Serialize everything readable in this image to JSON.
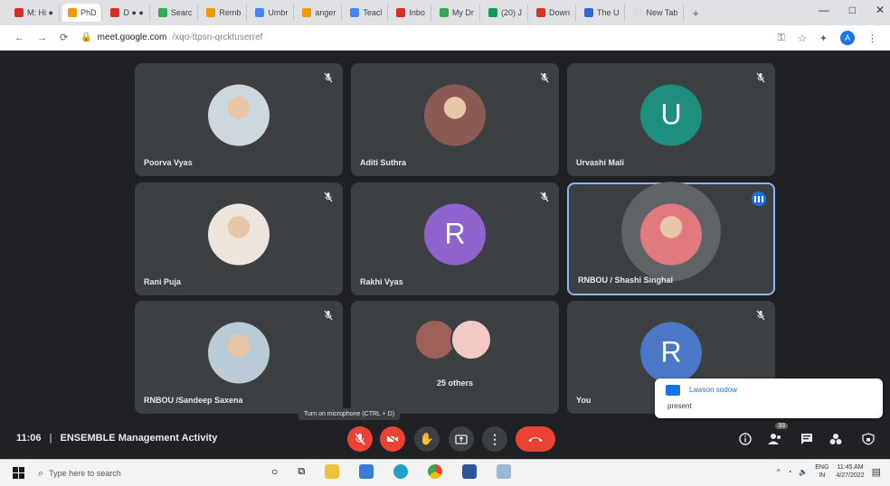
{
  "browser": {
    "tabs": [
      {
        "label": "M: Hi ●",
        "color": "#d93025"
      },
      {
        "label": "PhD",
        "color": "#f29900"
      },
      {
        "label": "D ● ●",
        "color": "#d93025"
      },
      {
        "label": "Searc",
        "color": "#34a853"
      },
      {
        "label": "Remb",
        "color": "#f29900"
      },
      {
        "label": "Umbr",
        "color": "#4285f4"
      },
      {
        "label": "anger",
        "color": "#f29900"
      },
      {
        "label": "Teacl",
        "color": "#4285f4"
      },
      {
        "label": "Inbo",
        "color": "#d93025"
      },
      {
        "label": "My Dr",
        "color": "#34a853"
      },
      {
        "label": "(20) J",
        "color": "#0f9d58"
      },
      {
        "label": "Down",
        "color": "#d93025"
      },
      {
        "label": "The U",
        "color": "#3367d6"
      },
      {
        "label": "New Tab",
        "color": "#dadce0"
      }
    ],
    "new_tab": "+",
    "window_controls": [
      "—",
      "□",
      "✕"
    ],
    "url_host": "meet.google.com",
    "url_path": "/xqo-ttpsn-qrcktuserref",
    "profile_initial": "A"
  },
  "tiles": [
    {
      "name": "Poorva Vyas",
      "kind": "photo",
      "photo_bg": "#cdd8de"
    },
    {
      "name": "Aditi Suthra",
      "kind": "photo",
      "photo_bg": "#8b5a55"
    },
    {
      "name": "Urvashi Mali",
      "kind": "initial",
      "initial": "U",
      "color": "#1e8e7e"
    },
    {
      "name": "Rani Puja",
      "kind": "photo",
      "photo_bg": "#ede5dc"
    },
    {
      "name": "Rakhi Vyas",
      "kind": "initial",
      "initial": "R",
      "color": "#8e63ce"
    },
    {
      "name": "RNBOU / Shashi Singhal",
      "kind": "photo",
      "photo_bg": "#e07a7f",
      "speaking": true
    },
    {
      "name": "RNBOU /Sandeep Saxena",
      "kind": "photo",
      "photo_bg": "#b9cbd7"
    },
    {
      "name": "",
      "kind": "others",
      "others_label": "25 others"
    },
    {
      "name": "You",
      "kind": "initial",
      "initial": "R",
      "color": "#4a78c6"
    }
  ],
  "tooltip": "Turn on microphone (CTRL + D)",
  "toast": {
    "sender": "Lawson sodow",
    "message": "present"
  },
  "meeting": {
    "time": "11:06",
    "separator": "|",
    "title": "ENSEMBLE Management Activity"
  },
  "controls": {
    "left": [
      "mic-off",
      "camera-off",
      "raise-hand",
      "present",
      "more",
      "hang-up"
    ],
    "right_people_count": "33"
  },
  "taskbar": {
    "search_placeholder": "Type here to search",
    "lang": "ENG",
    "lang_sub": "IN",
    "time": "11:45 AM",
    "date": "4/27/2022"
  }
}
